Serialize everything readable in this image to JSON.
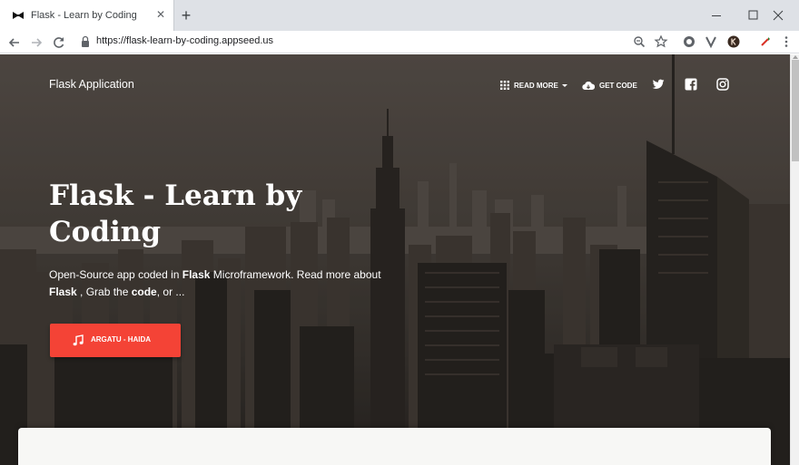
{
  "browser": {
    "tab": {
      "title": "Flask - Learn by Coding",
      "close": "✕"
    },
    "new_tab": "+",
    "url": "https://flask-learn-by-coding.appseed.us"
  },
  "navbar": {
    "brand": "Flask Application",
    "read_more": "READ MORE",
    "get_code": "GET CODE"
  },
  "hero": {
    "title": "Flask - Learn by Coding",
    "description": {
      "t1": "Open-Source app coded in ",
      "b1": "Flask",
      "t2": " Microframework. Read more about ",
      "b2": "Flask",
      "t3": " , Grab the ",
      "b3": "code",
      "t4": ", or ..."
    },
    "cta_label": "ARGATU - HAIDA"
  },
  "colors": {
    "cta": "#f44336",
    "card": "#f7f7f5"
  }
}
